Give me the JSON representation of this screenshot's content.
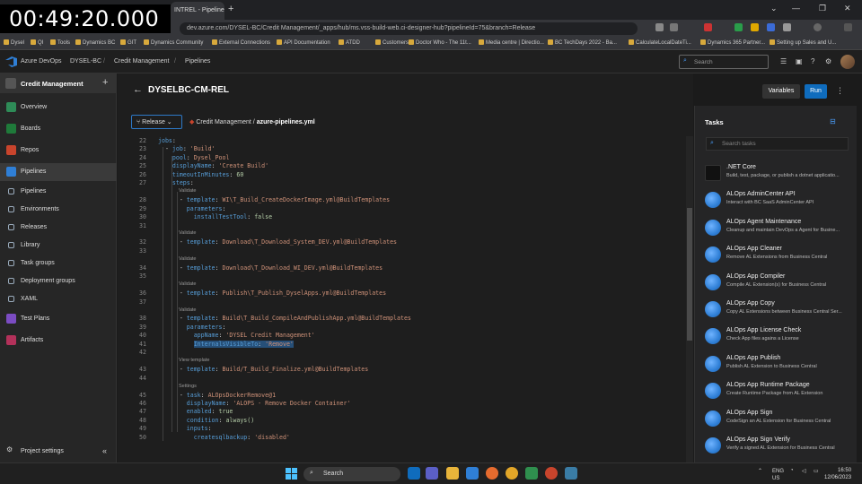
{
  "overlay": {
    "timer": "00:49:20.000"
  },
  "browser": {
    "tab_title": "INTREL - Pipelines",
    "new_tab": "+",
    "url": "dev.azure.com/DYSEL-BC/Credit Management/_apps/hub/ms.vss-build-web.ci-designer-hub?pipelineId=75&branch=Release",
    "bookmarks": [
      "Dysel",
      "QI",
      "Tools",
      "Dynamics BC",
      "GIT",
      "Dynamics Community",
      "External Connections",
      "API Documentation",
      "ATDD",
      "Customers",
      "Doctor Who - The 11t...",
      "Media centre | Directio...",
      "BC TechDays 2022 - Ba...",
      "CalculateLocalDateTi...",
      "Dynamics 365 Partner...",
      "Setting up Sales and U..."
    ]
  },
  "header": {
    "product": "Azure DevOps",
    "org": "DYSEL-BC",
    "project": "Credit Management",
    "section": "Pipelines",
    "search_placeholder": "Search"
  },
  "sidebar": {
    "project": "Credit Management",
    "items": [
      {
        "label": "Overview",
        "color": "#2e8b57"
      },
      {
        "label": "Boards",
        "color": "#1f7a3a"
      },
      {
        "label": "Repos",
        "color": "#c8442c"
      },
      {
        "label": "Pipelines",
        "color": "#2f7fd6"
      },
      {
        "label": "Pipelines",
        "sub": true
      },
      {
        "label": "Environments",
        "sub": true
      },
      {
        "label": "Releases",
        "sub": true
      },
      {
        "label": "Library",
        "sub": true
      },
      {
        "label": "Task groups",
        "sub": true
      },
      {
        "label": "Deployment groups",
        "sub": true
      },
      {
        "label": "XAML",
        "sub": true
      },
      {
        "label": "Test Plans",
        "color": "#7b4cc2"
      },
      {
        "label": "Artifacts",
        "color": "#b3315a"
      }
    ],
    "settings": "Project settings"
  },
  "main": {
    "title": "DYSELBC-CM-REL",
    "variables": "Variables",
    "run": "Run",
    "branch": "Release",
    "path_repo": "Credit Management",
    "path_sep": "/",
    "path_file": "azure-pipelines.yml"
  },
  "editor": {
    "lines": [
      {
        "n": "22",
        "t": "jobs:"
      },
      {
        "n": "23",
        "t": "  - job: 'Build'"
      },
      {
        "n": "24",
        "t": "    pool: Dysel_Pool"
      },
      {
        "n": "25",
        "t": "    displayName: 'Create Build'"
      },
      {
        "n": "26",
        "t": "    timeoutInMinutes: 60"
      },
      {
        "n": "27",
        "t": "    steps:"
      },
      {
        "lens": "Validate"
      },
      {
        "n": "28",
        "t": "      - template: WI\\T_Build_CreateDockerImage.yml@BuildTemplates"
      },
      {
        "n": "29",
        "t": "        parameters:"
      },
      {
        "n": "30",
        "t": "          installTestTool: false"
      },
      {
        "n": "31",
        "t": ""
      },
      {
        "lens": "Validate"
      },
      {
        "n": "32",
        "t": "      - template: Download\\T_Download_System_DEV.yml@BuildTemplates"
      },
      {
        "n": "33",
        "t": ""
      },
      {
        "lens": "Validate"
      },
      {
        "n": "34",
        "t": "      - template: Download\\T_Download_WI_DEV.yml@BuildTemplates"
      },
      {
        "n": "35",
        "t": ""
      },
      {
        "lens": "Validate"
      },
      {
        "n": "36",
        "t": "      - template: Publish\\T_Publish_DyselApps.yml@BuildTemplates"
      },
      {
        "n": "37",
        "t": ""
      },
      {
        "lens": "Validate"
      },
      {
        "n": "38",
        "t": "      - template: Build\\T_Build_CompileAndPublishApp.yml@BuildTemplates"
      },
      {
        "n": "39",
        "t": "        parameters:"
      },
      {
        "n": "40",
        "t": "          appName: 'DYSEL Credit Management'"
      },
      {
        "n": "41",
        "t": "          InternalsVisibleTo: 'Remove'"
      },
      {
        "n": "42",
        "t": ""
      },
      {
        "lens": "View template"
      },
      {
        "n": "43",
        "t": "      - template: Build/T_Build_Finalize.yml@BuildTemplates"
      },
      {
        "n": "44",
        "t": ""
      },
      {
        "lens": "Settings"
      },
      {
        "n": "45",
        "t": "      - task: ALOpsDockerRemove@1"
      },
      {
        "n": "46",
        "t": "        displayName: 'ALOPS - Remove Docker Container'"
      },
      {
        "n": "47",
        "t": "        enabled: true"
      },
      {
        "n": "48",
        "t": "        condition: always()"
      },
      {
        "n": "49",
        "t": "        inputs:"
      },
      {
        "n": "50",
        "t": "          createsqlbackup: 'disabled'"
      }
    ]
  },
  "tasks": {
    "title": "Tasks",
    "search_placeholder": "Search tasks",
    "items": [
      {
        "name": ".NET Core",
        "desc": "Build, test, package, or publish a dotnet applicatio...",
        "icon": "dotnet"
      },
      {
        "name": "ALOps AdminCenter API",
        "desc": "Interact with BC SaaS AdminCenter API"
      },
      {
        "name": "ALOps Agent Maintenance",
        "desc": "Cleanup and maintain DevOps a Agent for Busine..."
      },
      {
        "name": "ALOps App Cleaner",
        "desc": "Remove AL Extensions from Business Central"
      },
      {
        "name": "ALOps App Compiler",
        "desc": "Compile AL Extension(s) for Business Central"
      },
      {
        "name": "ALOps App Copy",
        "desc": "Copy AL Extensions between Business Central Ser..."
      },
      {
        "name": "ALOps App License Check",
        "desc": "Check App files agains a License"
      },
      {
        "name": "ALOps App Publish",
        "desc": "Publish AL Extension to Business Central"
      },
      {
        "name": "ALOps App Runtime Package",
        "desc": "Create Runtime Package from AL Extension"
      },
      {
        "name": "ALOps App Sign",
        "desc": "CodeSign an AL Extension for Business Central"
      },
      {
        "name": "ALOps App Sign Verify",
        "desc": "Verify a signed AL Extension for Business Central"
      }
    ]
  },
  "taskbar": {
    "search": "Search",
    "lang": "ENG",
    "region": "US",
    "time": "16:50",
    "date": "12/06/2023"
  }
}
